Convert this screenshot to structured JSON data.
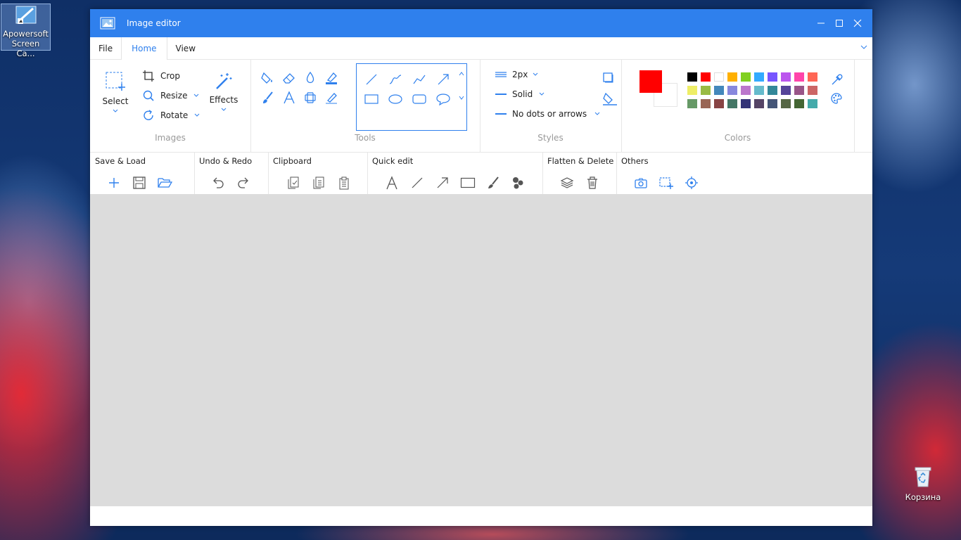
{
  "desktop": {
    "apowersoft_label": "Apowersoft Screen Ca...",
    "recycle_label": "Корзина"
  },
  "window": {
    "title": "Image editor",
    "minimize_icon": "minimize-icon",
    "maximize_icon": "maximize-icon",
    "close_icon": "close-icon"
  },
  "menu": {
    "tabs": [
      "File",
      "Home",
      "View"
    ],
    "active": "Home"
  },
  "ribbon": {
    "images": {
      "label": "Images",
      "select": "Select",
      "crop": "Crop",
      "resize": "Resize",
      "rotate": "Rotate",
      "effects": "Effects"
    },
    "tools": {
      "label": "Tools",
      "items": [
        "fill-icon",
        "eraser-icon",
        "blur-drop-icon",
        "highlighter-icon",
        "brush-icon",
        "text-icon",
        "mosaic-icon",
        "marker-icon"
      ],
      "shapes": [
        "line-shape",
        "curve-shape",
        "polyline-shape",
        "arrow-shape",
        "rectangle-shape",
        "ellipse-shape",
        "rounded-rect-shape",
        "callout-shape"
      ]
    },
    "styles": {
      "label": "Styles",
      "size": "2px",
      "line": "Solid",
      "ends": "No dots or arrows"
    },
    "colors": {
      "label": "Colors",
      "primary": "#ff0000",
      "secondary": "#ffffff",
      "palette": [
        [
          "#000000",
          "#ff0000",
          "#ffffff",
          "#ffb000",
          "#80d020",
          "#33aaff",
          "#7755ff",
          "#bb55ee",
          "#ff44aa",
          "#ff6655"
        ],
        [
          "#eeee66",
          "#99bb44",
          "#4488bb",
          "#8888dd",
          "#bb77cc",
          "#66bbcc",
          "#338899",
          "#554499",
          "#995588",
          "#cc6666"
        ],
        [
          "#669966",
          "#996655",
          "#884444",
          "#447766",
          "#333377",
          "#554466",
          "#445577",
          "#556644",
          "#446633",
          "#44aaaa"
        ]
      ]
    }
  },
  "toolbar": {
    "save_load": "Save & Load",
    "undo_redo": "Undo & Redo",
    "clipboard": "Clipboard",
    "quick_edit": "Quick edit",
    "flatten_delete": "Flatten & Delete",
    "others": "Others"
  },
  "theme": {
    "accent": "#2f80ed",
    "canvas": "#dcdcdc"
  }
}
